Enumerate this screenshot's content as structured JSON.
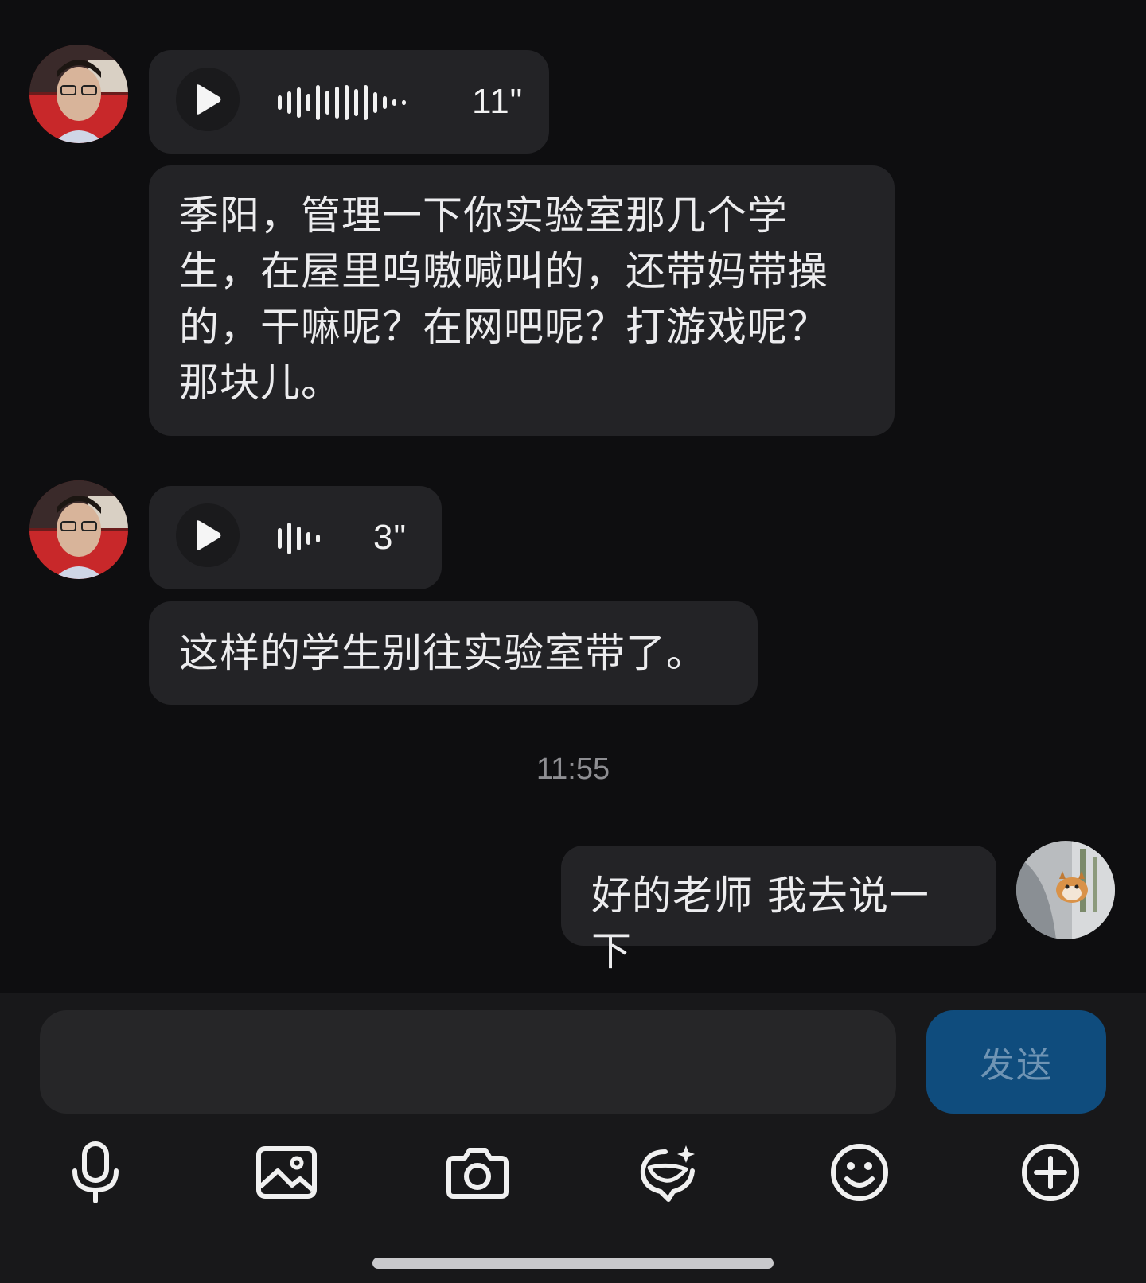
{
  "messages": [
    {
      "sender": "teacher",
      "type": "voice",
      "duration": "11\""
    },
    {
      "sender": "teacher",
      "type": "text",
      "text": "季阳，管理一下你实验室那几个学生，在屋里呜嗷喊叫的，还带妈带操的，干嘛呢？在网吧呢？打游戏呢？那块儿。"
    },
    {
      "sender": "teacher",
      "type": "voice",
      "duration": "3\""
    },
    {
      "sender": "teacher",
      "type": "text",
      "text": "这样的学生别往实验室带了。"
    },
    {
      "sender": "me",
      "type": "text",
      "text": "好的老师 我去说一下"
    }
  ],
  "timestamp": "11:55",
  "composer": {
    "input_value": "",
    "send_label": "发送"
  },
  "toolbar_icons": [
    "microphone-icon",
    "image-icon",
    "camera-icon",
    "sticker-icon",
    "emoji-icon",
    "plus-icon"
  ],
  "colors": {
    "background": "#0e0e10",
    "bubble": "#232326",
    "send_button": "#0f4c7d",
    "send_text": "#6f94b4"
  }
}
